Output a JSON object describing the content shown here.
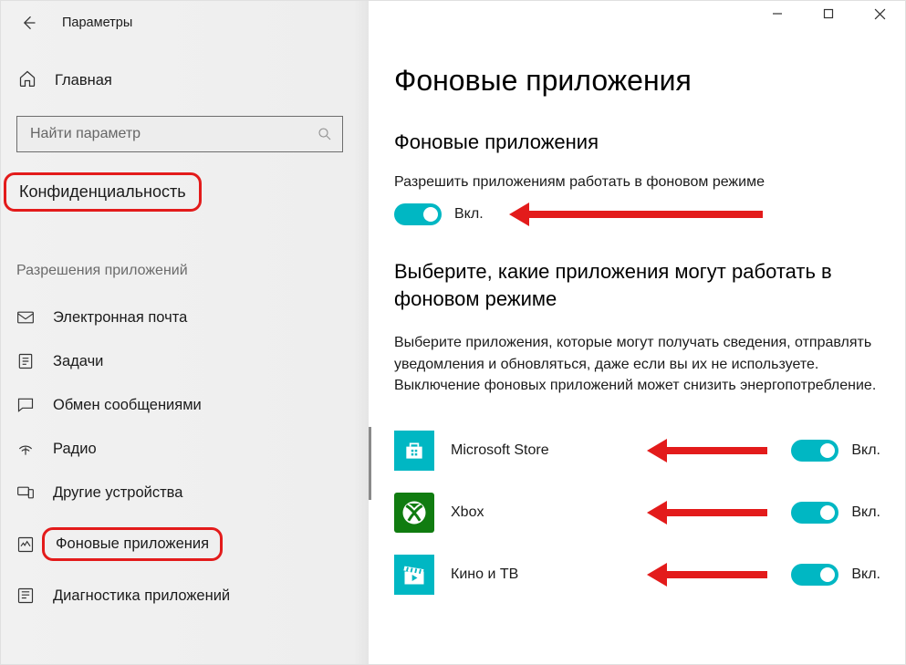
{
  "header": {
    "app_title": "Параметры"
  },
  "sidebar": {
    "home": "Главная",
    "search_placeholder": "Найти параметр",
    "category": "Конфиденциальность",
    "group_label": "Разрешения приложений",
    "items": [
      {
        "label": "Электронная почта",
        "icon": "mail"
      },
      {
        "label": "Задачи",
        "icon": "tasks"
      },
      {
        "label": "Обмен сообщениями",
        "icon": "messaging"
      },
      {
        "label": "Радио",
        "icon": "radio"
      },
      {
        "label": "Другие устройства",
        "icon": "devices"
      },
      {
        "label": "Фоновые приложения",
        "icon": "background",
        "highlighted": true
      },
      {
        "label": "Диагностика приложений",
        "icon": "diagnostics"
      }
    ]
  },
  "main": {
    "page_title": "Фоновые приложения",
    "section1_title": "Фоновые приложения",
    "master_label": "Разрешить приложениям работать в фоновом режиме",
    "master_state_text": "Вкл.",
    "section2_title": "Выберите, какие приложения могут работать в фоновом режиме",
    "help_text": "Выберите приложения, которые могут получать сведения, отправлять уведомления и обновляться, даже если вы их не используете. Выключение фоновых приложений может снизить энергопотребление.",
    "apps": [
      {
        "name": "Microsoft Store",
        "state_text": "Вкл.",
        "tile": "store"
      },
      {
        "name": "Xbox",
        "state_text": "Вкл.",
        "tile": "xbox"
      },
      {
        "name": "Кино и ТВ",
        "state_text": "Вкл.",
        "tile": "movies"
      }
    ]
  },
  "colors": {
    "accent": "#00b7c3",
    "annotation": "#e31b1b"
  }
}
